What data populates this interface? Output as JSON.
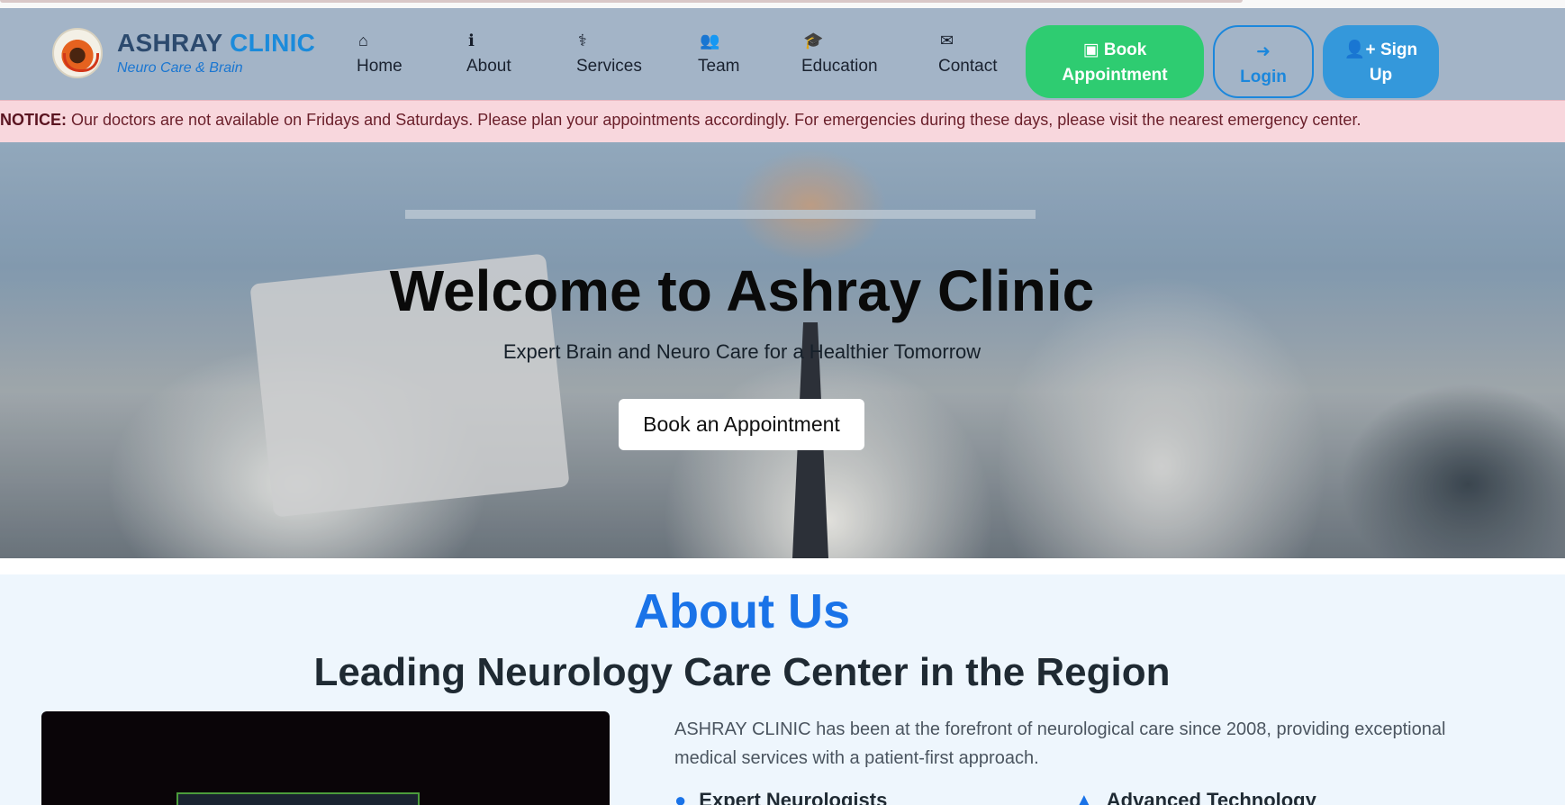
{
  "brand": {
    "title_main": "ASHRAY",
    "title_accent": "CLINIC",
    "subtitle": "Neuro Care & Brain",
    "logo_icon": "clinic-logo"
  },
  "nav": {
    "items": [
      {
        "label": "Home",
        "icon": "home-icon",
        "glyph": "⌂"
      },
      {
        "label": "About",
        "icon": "info-icon",
        "glyph": "ℹ"
      },
      {
        "label": "Services",
        "icon": "stethoscope-icon",
        "glyph": "⚕"
      },
      {
        "label": "Team",
        "icon": "users-icon",
        "glyph": "👥"
      },
      {
        "label": "Education",
        "icon": "graduation-cap-icon",
        "glyph": "🎓"
      },
      {
        "label": "Contact",
        "icon": "envelope-icon",
        "glyph": "✉"
      }
    ],
    "book_label_line1": "Book",
    "book_label_line2": "Appointment",
    "login_label": "Login",
    "signup_label_line1": "Sign",
    "signup_label_line2": "Up"
  },
  "notice": {
    "lead": "NOTICE:",
    "text": " Our doctors are not available on Fridays and Saturdays. Please plan your appointments accordingly. For emergencies during these days, please visit the nearest emergency center."
  },
  "hero": {
    "title": "Welcome to Ashray Clinic",
    "subtitle": "Expert Brain and Neuro Care for a Healthier Tomorrow",
    "cta": "Book an Appointment"
  },
  "about": {
    "title": "About Us",
    "subtitle": "Leading Neurology Care Center in the Region",
    "text": "ASHRAY CLINIC has been at the forefront of neurological care since 2008, providing exceptional medical services with a patient-first approach.",
    "features": [
      "Expert Neurologists",
      "Advanced Technology"
    ]
  },
  "colors": {
    "navbar": "#a3b4c7",
    "book_button": "#2ecc71",
    "signup_button": "#3498db",
    "accent_blue": "#1a73e8",
    "notice_bg": "#f8d7dd"
  }
}
